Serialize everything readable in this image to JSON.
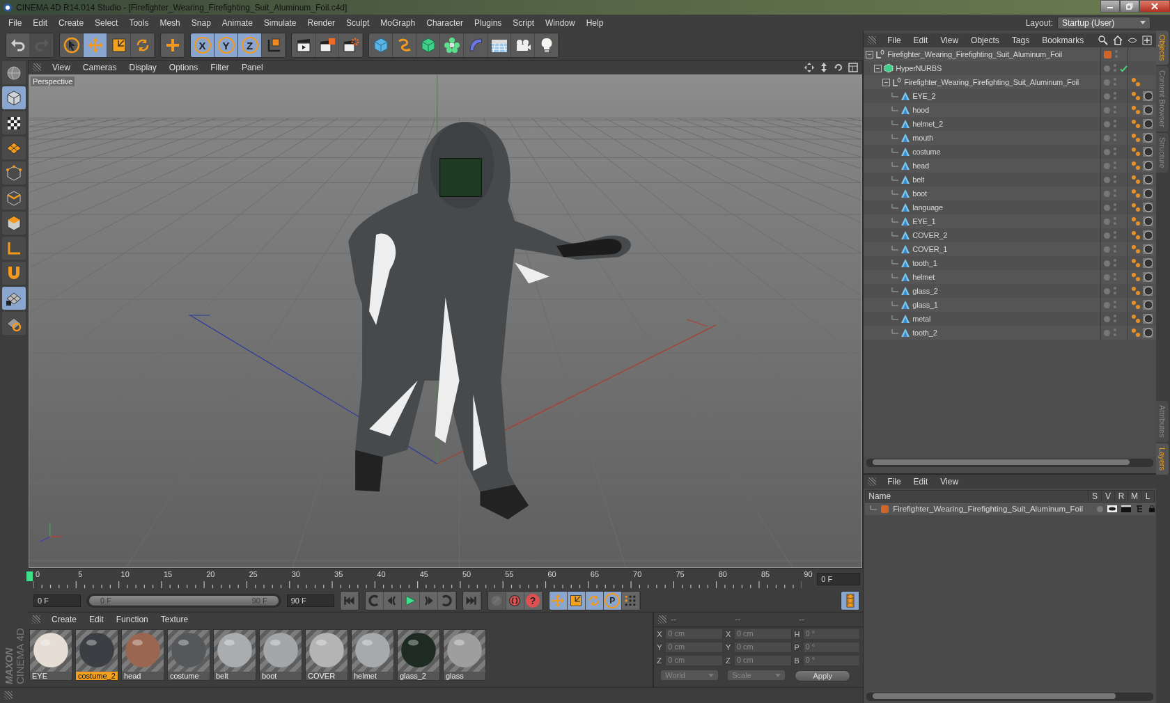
{
  "window": {
    "title": "CINEMA 4D R14.014 Studio - [Firefighter_Wearing_Firefighting_Suit_Aluminum_Foil.c4d]"
  },
  "menu": [
    "File",
    "Edit",
    "Create",
    "Select",
    "Tools",
    "Mesh",
    "Snap",
    "Animate",
    "Simulate",
    "Render",
    "Sculpt",
    "MoGraph",
    "Character",
    "Plugins",
    "Script",
    "Window",
    "Help"
  ],
  "layout": {
    "label": "Layout:",
    "value": "Startup (User)"
  },
  "toolbar": [
    [
      {
        "kind": "icon",
        "selected": false,
        "disabled": false
      },
      {
        "kind": "icon",
        "selected": false,
        "disabled": true
      }
    ],
    [
      {
        "kind": "icon",
        "selected": false,
        "disabled": false
      },
      {
        "kind": "icon",
        "selected": true,
        "disabled": false
      },
      {
        "kind": "icon",
        "selected": false,
        "disabled": false
      },
      {
        "kind": "icon",
        "selected": false,
        "disabled": false
      }
    ],
    [
      {
        "kind": "icon",
        "selected": false,
        "disabled": false
      }
    ],
    [
      {
        "kind": "axis",
        "label": "X",
        "selected": true,
        "disabled": false
      },
      {
        "kind": "axis",
        "label": "Y",
        "selected": true,
        "disabled": false
      },
      {
        "kind": "axis",
        "label": "Z",
        "selected": true,
        "disabled": false
      },
      {
        "kind": "icon",
        "selected": false,
        "disabled": false
      }
    ],
    [
      {
        "kind": "icon",
        "selected": false,
        "disabled": false
      },
      {
        "kind": "icon",
        "selected": false,
        "disabled": false
      },
      {
        "kind": "icon",
        "selected": false,
        "disabled": false
      }
    ],
    [
      {
        "kind": "icon",
        "selected": false,
        "disabled": false
      },
      {
        "kind": "icon",
        "selected": false,
        "disabled": false
      },
      {
        "kind": "icon",
        "selected": false,
        "disabled": false
      },
      {
        "kind": "icon",
        "selected": false,
        "disabled": false
      },
      {
        "kind": "icon",
        "selected": false,
        "disabled": false
      },
      {
        "kind": "icon",
        "selected": false,
        "disabled": false
      },
      {
        "kind": "icon",
        "selected": false,
        "disabled": false
      },
      {
        "kind": "icon",
        "selected": false,
        "disabled": false
      }
    ]
  ],
  "left_tools": [
    {
      "selected": false
    },
    {
      "selected": true
    },
    {
      "selected": false
    },
    {
      "selected": false
    },
    {
      "selected": false
    },
    {
      "selected": false
    },
    {
      "selected": false
    },
    {
      "selected": false
    },
    {
      "selected": false
    },
    {
      "selected": true
    },
    {
      "selected": false
    }
  ],
  "viewport": {
    "menu": [
      "View",
      "Cameras",
      "Display",
      "Options",
      "Filter",
      "Panel"
    ],
    "label": "Perspective"
  },
  "objects": {
    "menu": [
      "File",
      "Edit",
      "View",
      "Objects",
      "Tags",
      "Bookmarks"
    ],
    "tree": [
      {
        "name": "Firefighter_Wearing_Firefighting_Suit_Aluminum_Foil",
        "kind": "null",
        "color": "#d0652a",
        "children": [
          {
            "name": "HyperNURBS",
            "kind": "nurbs",
            "enabled": true,
            "children": [
              {
                "name": "Firefighter_Wearing_Firefighting_Suit_Aluminum_Foil",
                "kind": "null",
                "children": [
                  {
                    "name": "EYE_2",
                    "kind": "polygon"
                  },
                  {
                    "name": "hood",
                    "kind": "polygon"
                  },
                  {
                    "name": "helmet_2",
                    "kind": "polygon"
                  },
                  {
                    "name": "mouth",
                    "kind": "polygon"
                  },
                  {
                    "name": "costume",
                    "kind": "polygon"
                  },
                  {
                    "name": "head",
                    "kind": "polygon"
                  },
                  {
                    "name": "belt",
                    "kind": "polygon"
                  },
                  {
                    "name": "boot",
                    "kind": "polygon"
                  },
                  {
                    "name": "language",
                    "kind": "polygon"
                  },
                  {
                    "name": "EYE_1",
                    "kind": "polygon"
                  },
                  {
                    "name": "COVER_2",
                    "kind": "polygon"
                  },
                  {
                    "name": "COVER_1",
                    "kind": "polygon"
                  },
                  {
                    "name": "tooth_1",
                    "kind": "polygon"
                  },
                  {
                    "name": "helmet",
                    "kind": "polygon"
                  },
                  {
                    "name": "glass_2",
                    "kind": "polygon"
                  },
                  {
                    "name": "glass_1",
                    "kind": "polygon"
                  },
                  {
                    "name": "metal",
                    "kind": "polygon"
                  },
                  {
                    "name": "tooth_2",
                    "kind": "polygon"
                  }
                ]
              }
            ]
          }
        ]
      }
    ]
  },
  "side_tabs_top": [
    {
      "label": "Objects",
      "selected": true
    },
    {
      "label": "Content Browser",
      "selected": false
    },
    {
      "label": "Structure",
      "selected": false
    }
  ],
  "side_tabs_bottom": [
    {
      "label": "Attributes",
      "selected": false
    },
    {
      "label": "Layers",
      "selected": true
    }
  ],
  "layers": {
    "menu": [
      "File",
      "Edit",
      "View"
    ],
    "columns": [
      "Name",
      "S",
      "V",
      "R",
      "M",
      "L"
    ],
    "rows": [
      {
        "name": "Firefighter_Wearing_Firefighting_Suit_Aluminum_Foil",
        "color": "#d0652a"
      }
    ]
  },
  "timeline": {
    "ticks": [
      "0",
      "5",
      "10",
      "15",
      "20",
      "25",
      "30",
      "35",
      "40",
      "45",
      "50",
      "55",
      "60",
      "65",
      "70",
      "75",
      "80",
      "85",
      "90"
    ],
    "playhead": {
      "level": 0
    },
    "current": "0 F",
    "start": "0 F",
    "range": {
      "start": "0 F",
      "end": "90 F",
      "level": 1
    },
    "end": "90 F"
  },
  "transport": [
    {
      "kind": "icon",
      "selected": false,
      "disabled": true
    },
    {
      "kind": "icon",
      "selected": false,
      "disabled": false
    },
    {
      "kind": "label",
      "label": "?",
      "selected": false,
      "disabled": false
    },
    {
      "kind": "icon",
      "selected": true,
      "disabled": false
    },
    {
      "kind": "icon",
      "selected": true,
      "disabled": false
    },
    {
      "kind": "icon",
      "selected": true,
      "disabled": false
    },
    {
      "kind": "label",
      "label": "P",
      "selected": true,
      "disabled": false
    },
    {
      "kind": "icon",
      "selected": false,
      "disabled": false
    },
    {
      "kind": "icon",
      "selected": true,
      "disabled": false
    }
  ],
  "materials": {
    "menu": [
      "Create",
      "Edit",
      "Function",
      "Texture"
    ],
    "items": [
      {
        "name": "EYE",
        "selected": false,
        "color": "#e6ddd4"
      },
      {
        "name": "costume_2",
        "selected": true,
        "color": "#3b3f43"
      },
      {
        "name": "head",
        "selected": false,
        "color": "#9a6650"
      },
      {
        "name": "costume",
        "selected": false,
        "color": "#55585b"
      },
      {
        "name": "belt",
        "selected": false,
        "color": "#a9adaf"
      },
      {
        "name": "boot",
        "selected": false,
        "color": "#a3a7a9"
      },
      {
        "name": "COVER",
        "selected": false,
        "color": "#b4b4b4"
      },
      {
        "name": "helmet",
        "selected": false,
        "color": "#a6aaac"
      },
      {
        "name": "glass_2",
        "selected": false,
        "color": "#1d2b23"
      },
      {
        "name": "glass",
        "selected": false,
        "color": "#9e9e9e"
      }
    ]
  },
  "coordinates": {
    "headers": [
      "--",
      "--",
      "--"
    ],
    "columns": [
      [
        {
          "label": "X",
          "value": "0 cm"
        },
        {
          "label": "Y",
          "value": "0 cm"
        },
        {
          "label": "Z",
          "value": "0 cm"
        }
      ],
      [
        {
          "label": "X",
          "value": "0 cm"
        },
        {
          "label": "Y",
          "value": "0 cm"
        },
        {
          "label": "Z",
          "value": "0 cm"
        }
      ],
      [
        {
          "label": "H",
          "value": "0 °"
        },
        {
          "label": "P",
          "value": "0 °"
        },
        {
          "label": "B",
          "value": "0 °"
        }
      ]
    ],
    "dropdowns": [
      "World",
      "Scale"
    ],
    "apply": "Apply"
  },
  "logo": {
    "brand": "MAXON",
    "product": "CINEMA 4D"
  }
}
